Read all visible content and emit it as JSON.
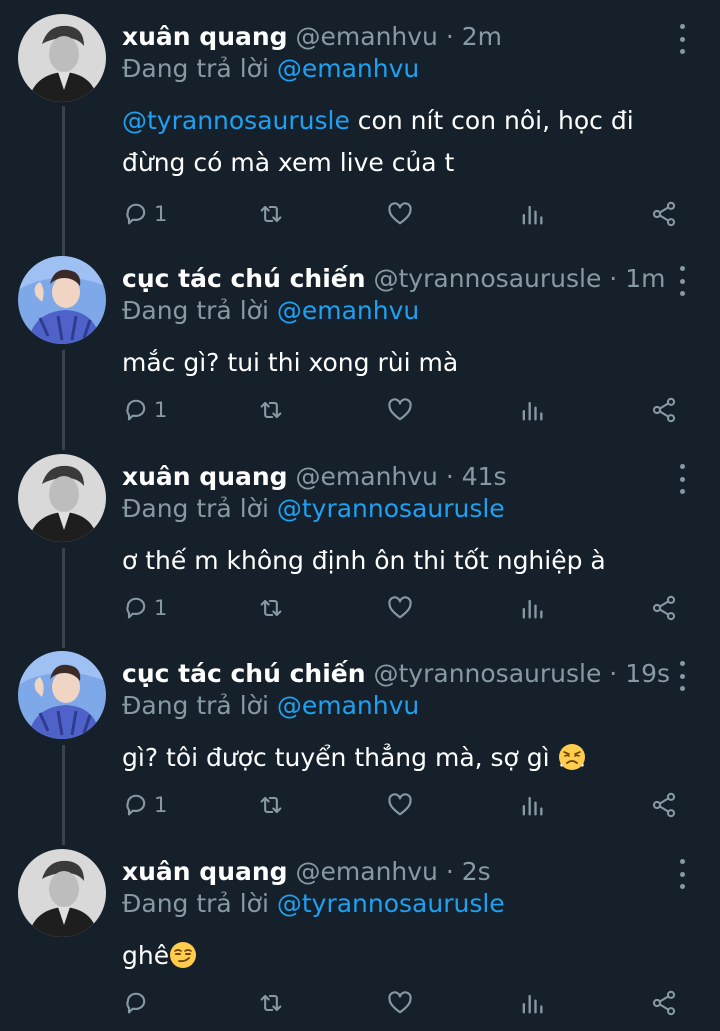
{
  "tweets": [
    {
      "name": "xuân quang",
      "handle": "@emanhvu",
      "time": "2m",
      "replying_label": "Đang trả lời",
      "replying_to": "@emanhvu",
      "mention": "@tyrannosaurusle",
      "text": " con nít con nôi, học đi đừng có mà xem live của t",
      "reply_count": "1"
    },
    {
      "name": "cục tác chú chiến",
      "handle": "@tyrannosaurusle",
      "time": "1m",
      "replying_label": "Đang trả lời",
      "replying_to": "@emanhvu",
      "text": "mắc gì? tui thi xong rùi mà",
      "reply_count": "1"
    },
    {
      "name": "xuân quang",
      "handle": "@emanhvu",
      "time": "41s",
      "replying_label": "Đang trả lời",
      "replying_to": "@tyrannosaurusle",
      "text": "ơ thế m không định ôn thi tốt nghiệp à",
      "reply_count": "1"
    },
    {
      "name": "cục tác chú chiến",
      "handle": "@tyrannosaurusle",
      "time": "19s",
      "replying_label": "Đang trả lời",
      "replying_to": "@emanhvu",
      "text": "gì? tôi được tuyển thẳng mà, sợ gì ",
      "emoji": "huffing-emoji",
      "reply_count": "1"
    },
    {
      "name": "xuân quang",
      "handle": "@emanhvu",
      "time": "2s",
      "replying_label": "Đang trả lời",
      "replying_to": "@tyrannosaurusle",
      "text": "ghê",
      "emoji": "smirk-emoji",
      "reply_count": ""
    }
  ],
  "separator": " · ",
  "colors": {
    "background": "#15202b",
    "secondary_text": "#8899a6",
    "link": "#1da1f2",
    "thread_line": "#38444d"
  },
  "icons": [
    "reply-icon",
    "retweet-icon",
    "like-icon",
    "analytics-icon",
    "share-icon",
    "more-icon"
  ]
}
